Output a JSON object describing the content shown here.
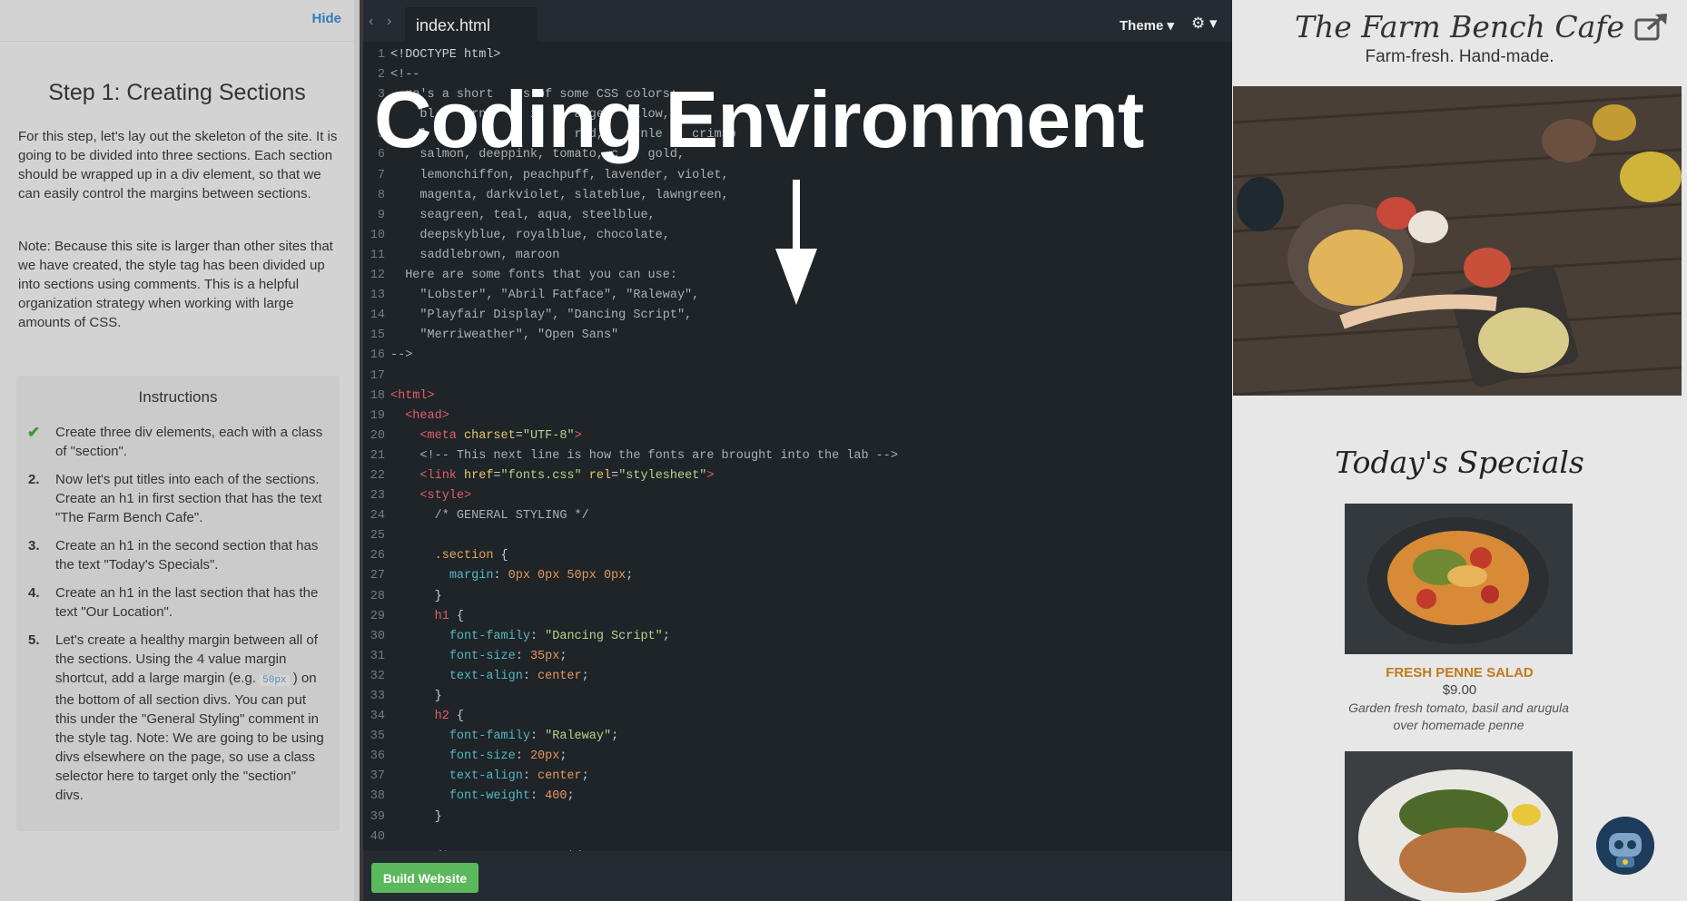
{
  "left_panel": {
    "hide_label": "Hide",
    "step_title": "Step 1: Creating Sections",
    "paragraphs": [
      "For this step, let's lay out the skeleton of the site. It is going to be divided into three sections. Each section should be wrapped up in a div element, so that we can easily control the margins between sections.",
      "Note: Because this site is larger than other sites that we have created, the style tag has been divided up into sections using comments. This is a helpful organization strategy when working with large amounts of CSS."
    ],
    "instructions": {
      "title": "Instructions",
      "items": [
        {
          "marker": "✔",
          "text": "Create three div elements, each with a class of \"section\"."
        },
        {
          "marker": "2.",
          "text": "Now let's put titles into each of the sections. Create an h1 in first section that has the text \"The Farm Bench Cafe\"."
        },
        {
          "marker": "3.",
          "text": "Create an h1 in the second section that has the text \"Today's Specials\"."
        },
        {
          "marker": "4.",
          "text": "Create an h1 in the last section that has the text \"Our Location\"."
        },
        {
          "marker": "5.",
          "text_before": "Let's create a healthy margin between all of the sections. Using the 4 value margin shortcut, add a large margin (e.g.",
          "code": "50px",
          "text_after": ") on the bottom of all section divs. You can put this under the \"General Styling\" comment in the style tag. Note: We are going to be using divs elsewhere on the page, so use a class selector here to target only the \"section\" divs."
        }
      ]
    }
  },
  "editor": {
    "nav_back": "‹",
    "nav_forward": "›",
    "tab_name": "index.html",
    "theme_label": "Theme ▾",
    "settings_label": "⚙ ▾",
    "build_button": "Build Website",
    "code_lines": [
      [
        [
          "c-kw",
          "<!DOCTYPE html>"
        ]
      ],
      [
        [
          "c-cm",
          "<!--"
        ]
      ],
      [
        [
          "c-cm",
          "  re's a short    s of some CSS colors:"
        ]
      ],
      [
        [
          "c-cm",
          "    bl     rn      i     ange    llow,"
        ]
      ],
      [
        [
          "c-cm",
          "    l        e           red,   urnle    crimso"
        ]
      ],
      [
        [
          "c-cm",
          "    salmon, deeppink, tomato, c    gold,"
        ]
      ],
      [
        [
          "c-cm",
          "    lemonchiffon, peachpuff, lavender, violet,"
        ]
      ],
      [
        [
          "c-cm",
          "    magenta, darkviolet, slateblue, lawngreen,"
        ]
      ],
      [
        [
          "c-cm",
          "    seagreen, teal, aqua, steelblue,"
        ]
      ],
      [
        [
          "c-cm",
          "    deepskyblue, royalblue, chocolate,"
        ]
      ],
      [
        [
          "c-cm",
          "    saddlebrown, maroon"
        ]
      ],
      [
        [
          "c-cm",
          "  Here are some fonts that you can use:"
        ]
      ],
      [
        [
          "c-cm",
          "    \"Lobster\", \"Abril Fatface\", \"Raleway\","
        ]
      ],
      [
        [
          "c-cm",
          "    \"Playfair Display\", \"Dancing Script\","
        ]
      ],
      [
        [
          "c-cm",
          "    \"Merriweather\", \"Open Sans\""
        ]
      ],
      [
        [
          "c-cm",
          "-->"
        ]
      ],
      [],
      [
        [
          "c-tag",
          "<html>"
        ]
      ],
      [
        [
          "c-kw",
          "  "
        ],
        [
          "c-tag",
          "<head>"
        ]
      ],
      [
        [
          "c-kw",
          "    "
        ],
        [
          "c-tag",
          "<meta "
        ],
        [
          "c-attr",
          "charset"
        ],
        [
          "c-kw",
          "="
        ],
        [
          "c-str",
          "\"UTF-8\""
        ],
        [
          "c-tag",
          ">"
        ]
      ],
      [
        [
          "c-cm",
          "    <!-- This next line is how the fonts are brought into the lab -->"
        ]
      ],
      [
        [
          "c-kw",
          "    "
        ],
        [
          "c-tag",
          "<link "
        ],
        [
          "c-attr",
          "href"
        ],
        [
          "c-kw",
          "="
        ],
        [
          "c-str",
          "\"fonts.css\""
        ],
        [
          "c-kw",
          " "
        ],
        [
          "c-attr",
          "rel"
        ],
        [
          "c-kw",
          "="
        ],
        [
          "c-str",
          "\"stylesheet\""
        ],
        [
          "c-tag",
          ">"
        ]
      ],
      [
        [
          "c-kw",
          "    "
        ],
        [
          "c-tag",
          "<style>"
        ]
      ],
      [
        [
          "c-cm",
          "      /* GENERAL STYLING */"
        ]
      ],
      [],
      [
        [
          "c-kw",
          "      "
        ],
        [
          "c-sel",
          ".section"
        ],
        [
          "c-kw",
          " {"
        ]
      ],
      [
        [
          "c-kw",
          "        "
        ],
        [
          "c-prop",
          "margin"
        ],
        [
          "c-kw",
          ": "
        ],
        [
          "c-num",
          "0px 0px 50px 0px"
        ],
        [
          "c-kw",
          ";"
        ]
      ],
      [
        [
          "c-kw",
          "      }"
        ]
      ],
      [
        [
          "c-kw",
          "      "
        ],
        [
          "c-tag",
          "h1"
        ],
        [
          "c-kw",
          " {"
        ]
      ],
      [
        [
          "c-kw",
          "        "
        ],
        [
          "c-prop",
          "font-family"
        ],
        [
          "c-kw",
          ": "
        ],
        [
          "c-str",
          "\"Dancing Script\""
        ],
        [
          "c-kw",
          ";"
        ]
      ],
      [
        [
          "c-kw",
          "        "
        ],
        [
          "c-prop",
          "font-size"
        ],
        [
          "c-kw",
          ": "
        ],
        [
          "c-num",
          "35px"
        ],
        [
          "c-kw",
          ";"
        ]
      ],
      [
        [
          "c-kw",
          "        "
        ],
        [
          "c-prop",
          "text-align"
        ],
        [
          "c-kw",
          ": "
        ],
        [
          "c-num",
          "center"
        ],
        [
          "c-kw",
          ";"
        ]
      ],
      [
        [
          "c-kw",
          "      }"
        ]
      ],
      [
        [
          "c-kw",
          "      "
        ],
        [
          "c-tag",
          "h2"
        ],
        [
          "c-kw",
          " {"
        ]
      ],
      [
        [
          "c-kw",
          "        "
        ],
        [
          "c-prop",
          "font-family"
        ],
        [
          "c-kw",
          ": "
        ],
        [
          "c-str",
          "\"Raleway\""
        ],
        [
          "c-kw",
          ";"
        ]
      ],
      [
        [
          "c-kw",
          "        "
        ],
        [
          "c-prop",
          "font-size"
        ],
        [
          "c-kw",
          ": "
        ],
        [
          "c-num",
          "20px"
        ],
        [
          "c-kw",
          ";"
        ]
      ],
      [
        [
          "c-kw",
          "        "
        ],
        [
          "c-prop",
          "text-align"
        ],
        [
          "c-kw",
          ": "
        ],
        [
          "c-num",
          "center"
        ],
        [
          "c-kw",
          ";"
        ]
      ],
      [
        [
          "c-kw",
          "        "
        ],
        [
          "c-prop",
          "font-weight"
        ],
        [
          "c-kw",
          ": "
        ],
        [
          "c-num",
          "400"
        ],
        [
          "c-kw",
          ";"
        ]
      ],
      [
        [
          "c-kw",
          "      }"
        ]
      ],
      [],
      [
        [
          "c-cm",
          "      /* BANNER SECTION */"
        ]
      ]
    ]
  },
  "overlay": {
    "title": "Coding Environment"
  },
  "preview": {
    "cafe_name": "The Farm Bench Cafe",
    "tagline": "Farm-fresh. Hand-made.",
    "specials_title": "Today's Specials",
    "dish": {
      "name": "Fresh Penne Salad",
      "price": "$9.00",
      "description": "Garden fresh tomato, basil and arugula over homemade penne"
    }
  }
}
